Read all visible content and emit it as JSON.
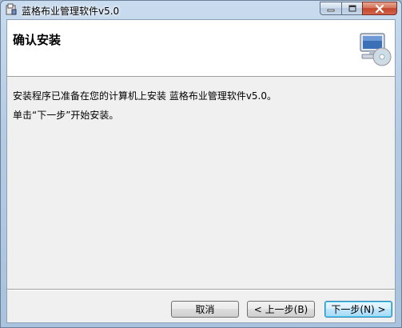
{
  "window": {
    "title": "蓝格布业管理软件v5.0"
  },
  "caption_buttons": {
    "minimize_icon": "minimize-icon",
    "maximize_icon": "maximize-icon",
    "close_icon": "close-icon"
  },
  "header": {
    "title": "确认安装",
    "icon": "computer-cd-icon"
  },
  "body": {
    "line1": "安装程序已准备在您的计算机上安装 蓝格布业管理软件v5.0。",
    "line2": "单击“下一步”开始安装。"
  },
  "buttons": {
    "cancel": "取消",
    "back": "< 上一步(B)",
    "next": "下一步(N) >"
  },
  "colors": {
    "close_button": "#c4452a",
    "default_button_border": "#3c7fb1"
  }
}
